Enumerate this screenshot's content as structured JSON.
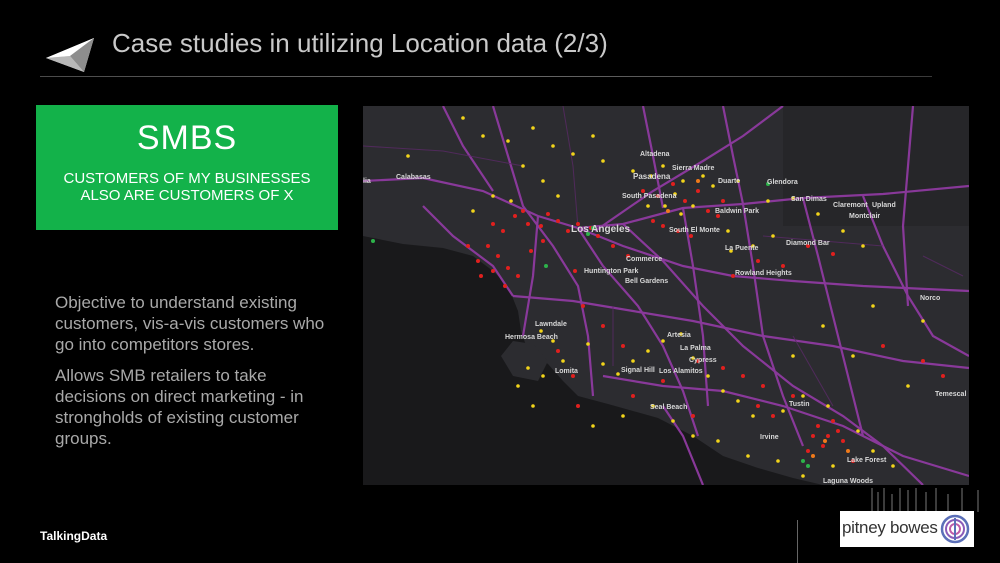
{
  "slide": {
    "title": "Case studies in utilizing Location data (2/3)",
    "brand": "TalkingData"
  },
  "smbs_box": {
    "title": "SMBS",
    "subtitle_line1": "CUSTOMERS OF MY BUSINESSES",
    "subtitle_line2": "ALSO ARE CUSTOMERS OF X",
    "color": "#13b24a"
  },
  "body": {
    "paragraph1": "Objective to understand existing customers, vis-a-vis customers who go into competitors stores.",
    "paragraph2": "Allows SMB retailers to take decisions on direct marketing - in strongholds of existing customer groups."
  },
  "map": {
    "labels": [
      {
        "id": "calabasas",
        "text": "Calabasas"
      },
      {
        "id": "altadena",
        "text": "Altadena"
      },
      {
        "id": "sierra-madre",
        "text": "Sierra Madre"
      },
      {
        "id": "pasadena",
        "text": "Pasadena"
      },
      {
        "id": "duarte",
        "text": "Duarte"
      },
      {
        "id": "glendora",
        "text": "Glendora"
      },
      {
        "id": "south-pasadena",
        "text": "South Pasadena"
      },
      {
        "id": "baldwin-park",
        "text": "Baldwin Park"
      },
      {
        "id": "san-dimas",
        "text": "San Dimas"
      },
      {
        "id": "claremont",
        "text": "Claremont"
      },
      {
        "id": "upland",
        "text": "Upland"
      },
      {
        "id": "montclair",
        "text": "Montclair"
      },
      {
        "id": "los-angeles",
        "text": "Los Angeles"
      },
      {
        "id": "south-el-monte",
        "text": "South El Monte"
      },
      {
        "id": "diamond-bar",
        "text": "Diamond Bar"
      },
      {
        "id": "la-puente",
        "text": "La Puente"
      },
      {
        "id": "commerce",
        "text": "Commerce"
      },
      {
        "id": "huntington-park",
        "text": "Huntington Park"
      },
      {
        "id": "rowland-heights",
        "text": "Rowland Heights"
      },
      {
        "id": "bell-gardens",
        "text": "Bell Gardens"
      },
      {
        "id": "norco",
        "text": "Norco"
      },
      {
        "id": "lawndale",
        "text": "Lawndale"
      },
      {
        "id": "hermosa-beach",
        "text": "Hermosa Beach"
      },
      {
        "id": "artesia",
        "text": "Artesia"
      },
      {
        "id": "la-palma",
        "text": "La Palma"
      },
      {
        "id": "cypress",
        "text": "Cypress"
      },
      {
        "id": "lomita",
        "text": "Lomita"
      },
      {
        "id": "signal-hill",
        "text": "Signal Hill"
      },
      {
        "id": "los-alamitos",
        "text": "Los Alamitos"
      },
      {
        "id": "temescal",
        "text": "Temescal"
      },
      {
        "id": "seal-beach",
        "text": "Seal Beach"
      },
      {
        "id": "tustin",
        "text": "Tustin"
      },
      {
        "id": "irvine",
        "text": "Irvine"
      },
      {
        "id": "lake-forest",
        "text": "Lake Forest"
      },
      {
        "id": "laguna-woods",
        "text": "Laguna Woods"
      },
      {
        "id": "lia",
        "text": "lia"
      }
    ],
    "colors": {
      "land": "#2b2b2e",
      "water": "#1a1a1c",
      "road": "#8a3a9a",
      "point_red": "#e0201e",
      "point_yellow": "#f2d41a",
      "point_green": "#2db34a",
      "point_orange": "#f07a1a"
    }
  },
  "partner_logo": {
    "text": "pitney bowes",
    "icon": "pitney-bowes-icon"
  }
}
